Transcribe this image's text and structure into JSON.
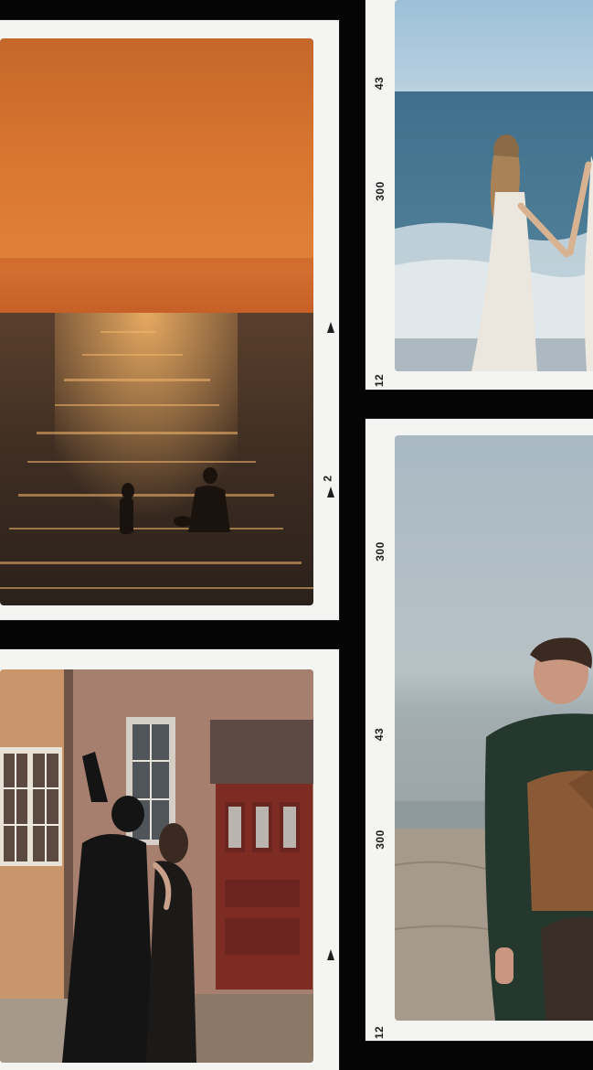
{
  "frames": [
    {
      "id": "sunset",
      "markings": [
        "2"
      ]
    },
    {
      "id": "shore",
      "markings": [
        "43",
        "300",
        "12"
      ]
    },
    {
      "id": "doorway",
      "markings": []
    },
    {
      "id": "beach",
      "markings": [
        "300",
        "43",
        "300",
        "12"
      ]
    }
  ],
  "colors": {
    "background": "#050505",
    "frame": "#f4f4f2",
    "sunset_sky": "#d9722e",
    "sea_blue": "#3d6f8c",
    "door_red": "#7e2b24"
  }
}
